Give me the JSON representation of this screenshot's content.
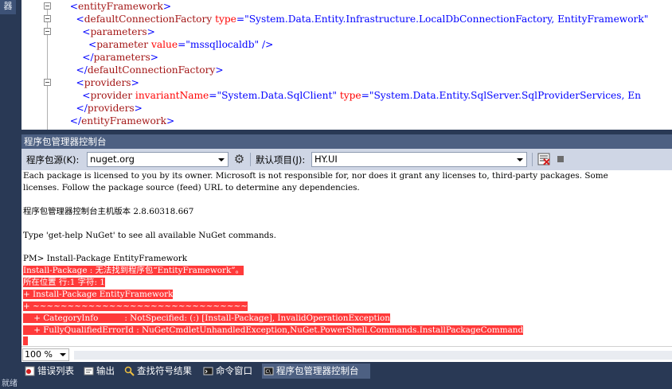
{
  "side_tab": "器",
  "editor": {
    "lines": [
      {
        "indent": "  ",
        "parts": [
          [
            "p",
            "<"
          ],
          [
            "t",
            "entityFramework"
          ],
          [
            "p",
            ">"
          ]
        ]
      },
      {
        "indent": "    ",
        "parts": [
          [
            "p",
            "<"
          ],
          [
            "t",
            "defaultConnectionFactory"
          ],
          [
            "a",
            " type"
          ],
          [
            "p",
            "=\""
          ],
          [
            "v",
            "System.Data.Entity.Infrastructure.LocalDbConnectionFactory, EntityFramework"
          ],
          [
            "p",
            "\""
          ]
        ]
      },
      {
        "indent": "      ",
        "parts": [
          [
            "p",
            "<"
          ],
          [
            "t",
            "parameters"
          ],
          [
            "p",
            ">"
          ]
        ]
      },
      {
        "indent": "        ",
        "parts": [
          [
            "p",
            "<"
          ],
          [
            "t",
            "parameter"
          ],
          [
            "a",
            " value"
          ],
          [
            "p",
            "=\""
          ],
          [
            "v",
            "mssqllocaldb"
          ],
          [
            "p",
            "\" />"
          ]
        ]
      },
      {
        "indent": "      ",
        "parts": [
          [
            "p",
            "</"
          ],
          [
            "t",
            "parameters"
          ],
          [
            "p",
            ">"
          ]
        ]
      },
      {
        "indent": "    ",
        "parts": [
          [
            "p",
            "</"
          ],
          [
            "t",
            "defaultConnectionFactory"
          ],
          [
            "p",
            ">"
          ]
        ]
      },
      {
        "indent": "    ",
        "parts": [
          [
            "p",
            "<"
          ],
          [
            "t",
            "providers"
          ],
          [
            "p",
            ">"
          ]
        ]
      },
      {
        "indent": "      ",
        "parts": [
          [
            "p",
            "<"
          ],
          [
            "t",
            "provider"
          ],
          [
            "a",
            " invariantName"
          ],
          [
            "p",
            "=\""
          ],
          [
            "v",
            "System.Data.SqlClient"
          ],
          [
            "p",
            "\""
          ],
          [
            "a",
            " type"
          ],
          [
            "p",
            "=\""
          ],
          [
            "v",
            "System.Data.Entity.SqlServer.SqlProviderServices, En"
          ]
        ]
      },
      {
        "indent": "    ",
        "parts": [
          [
            "p",
            "</"
          ],
          [
            "t",
            "providers"
          ],
          [
            "p",
            ">"
          ]
        ]
      },
      {
        "indent": "  ",
        "parts": [
          [
            "p",
            "</"
          ],
          [
            "t",
            "entityFramework"
          ],
          [
            "p",
            ">"
          ]
        ]
      }
    ]
  },
  "pm": {
    "title": "程序包管理器控制台",
    "source_label": "程序包源(K):",
    "source_value": "nuget.org",
    "default_project_label": "默认项目(J):",
    "default_project_value": "HY.UI"
  },
  "console": {
    "lines": [
      {
        "text": "Each package is licensed to you by its owner. Microsoft is not responsible for, nor does it grant any licenses to, third-party packages. Some",
        "error": false
      },
      {
        "text": "licenses. Follow the package source (feed) URL to determine any dependencies.",
        "error": false
      },
      {
        "text": "",
        "error": false
      },
      {
        "text": "程序包管理器控制台主机版本 2.8.60318.667",
        "error": false
      },
      {
        "text": "",
        "error": false
      },
      {
        "text": "Type 'get-help NuGet' to see all available NuGet commands.",
        "error": false
      },
      {
        "text": "",
        "error": false
      },
      {
        "text": "PM> Install-Package EntityFramework",
        "error": false
      },
      {
        "text": "Install-Package : 无法找到程序包“EntityFramework”。",
        "error": true
      },
      {
        "text": "所在位置 行:1 字符: 1",
        "error": true
      },
      {
        "text": "+ Install-Package EntityFramework",
        "error": true
      },
      {
        "text": "+ ~~~~~~~~~~~~~~~~~~~~~~~~~~~~~~~",
        "error": true
      },
      {
        "text": "    + CategoryInfo          : NotSpecified: (:) [Install-Package], InvalidOperationException",
        "error": true
      },
      {
        "text": "    + FullyQualifiedErrorId : NuGetCmdletUnhandledException,NuGet.PowerShell.Commands.InstallPackageCommand",
        "error": true
      }
    ],
    "zoom": "100 %"
  },
  "tabs": [
    {
      "label": "错误列表",
      "icon": "error-list-icon",
      "active": false
    },
    {
      "label": "输出",
      "icon": "output-icon",
      "active": false
    },
    {
      "label": "查找符号结果",
      "icon": "find-symbol-icon",
      "active": false
    },
    {
      "label": "命令窗口",
      "icon": "command-window-icon",
      "active": false
    },
    {
      "label": "程序包管理器控制台",
      "icon": "package-console-icon",
      "active": true
    }
  ],
  "status_text": "就绪",
  "colors": {
    "error_bg": "#ff3a3a",
    "frame": "#293955",
    "panel_title": "#4d6082"
  }
}
